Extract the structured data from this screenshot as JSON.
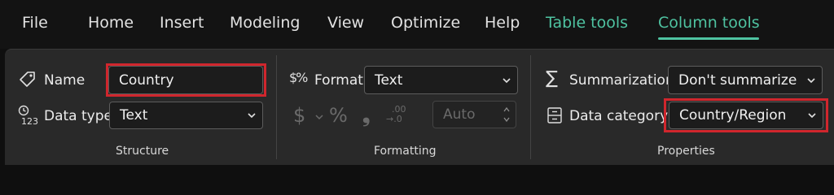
{
  "menu": {
    "file": "File",
    "home": "Home",
    "insert": "Insert",
    "modeling": "Modeling",
    "view": "View",
    "optimize": "Optimize",
    "help": "Help",
    "table_tools": "Table tools",
    "column_tools": "Column tools"
  },
  "structure": {
    "name_label": "Name",
    "name_value": "Country",
    "datatype_label": "Data type",
    "datatype_value": "Text",
    "group_label": "Structure",
    "datatype_icon_text": "123"
  },
  "formatting": {
    "format_label": "Format",
    "format_value": "Text",
    "currency_symbol": "$",
    "percent_symbol": "%",
    "comma_symbol": "❟",
    "decimal_top": ".00",
    "decimal_bottom": "→.0",
    "decimals_placeholder": "Auto",
    "group_label": "Formatting",
    "format_icon_text": "$%"
  },
  "properties": {
    "summarization_label": "Summarization",
    "summarization_value": "Don't summarize",
    "datacategory_label": "Data category",
    "datacategory_value": "Country/Region",
    "group_label": "Properties",
    "sigma_symbol": "∑"
  },
  "colors": {
    "accent_contextual": "#4fc3a1",
    "highlight_box": "#d0262d"
  }
}
